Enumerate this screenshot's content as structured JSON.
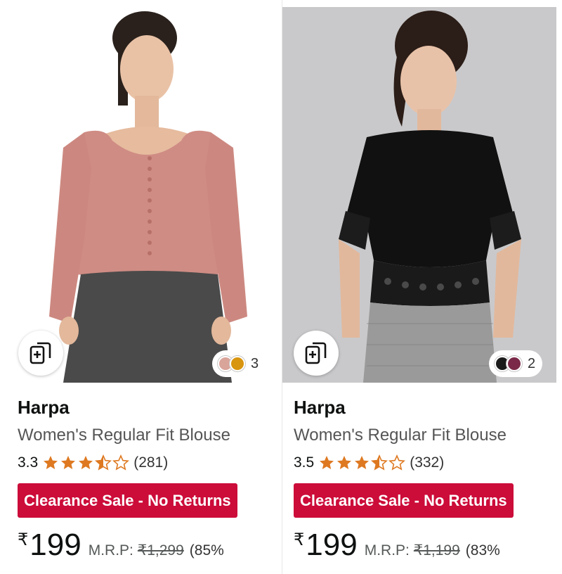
{
  "products": [
    {
      "brand": "Harpa",
      "title": "Women's Regular Fit Blouse",
      "rating": "3.3",
      "stars": 3.5,
      "review_count": "(281)",
      "badge": "Clearance Sale - No Returns",
      "currency": "₹",
      "price": "199",
      "mrp_label": "M.R.P:",
      "mrp_value": "₹1,299",
      "discount": "(85%",
      "swatch_count": "3",
      "swatch_colors": [
        "#d9a49a",
        "#d8950f"
      ],
      "image_description_colors": {
        "top": "#cf8c84",
        "pants": "#4a4a4a",
        "bg": "#ffffff"
      },
      "compare_icon": "compare-cards-icon"
    },
    {
      "brand": "Harpa",
      "title": "Women's Regular Fit Blouse",
      "rating": "3.5",
      "stars": 3.5,
      "review_count": "(332)",
      "badge": "Clearance Sale - No Returns",
      "currency": "₹",
      "price": "199",
      "mrp_label": "M.R.P:",
      "mrp_value": "₹1,199",
      "discount": "(83%",
      "swatch_count": "2",
      "swatch_colors": [
        "#1a1a1a",
        "#7a2a48"
      ],
      "image_description_colors": {
        "top": "#111111",
        "pants": "#9a9a9a",
        "bg": "#c9c9cb"
      },
      "compare_icon": "compare-cards-icon"
    }
  ],
  "colors": {
    "star": "#de7921",
    "badge_bg": "#cc0c39",
    "badge_text": "#ffffff"
  }
}
